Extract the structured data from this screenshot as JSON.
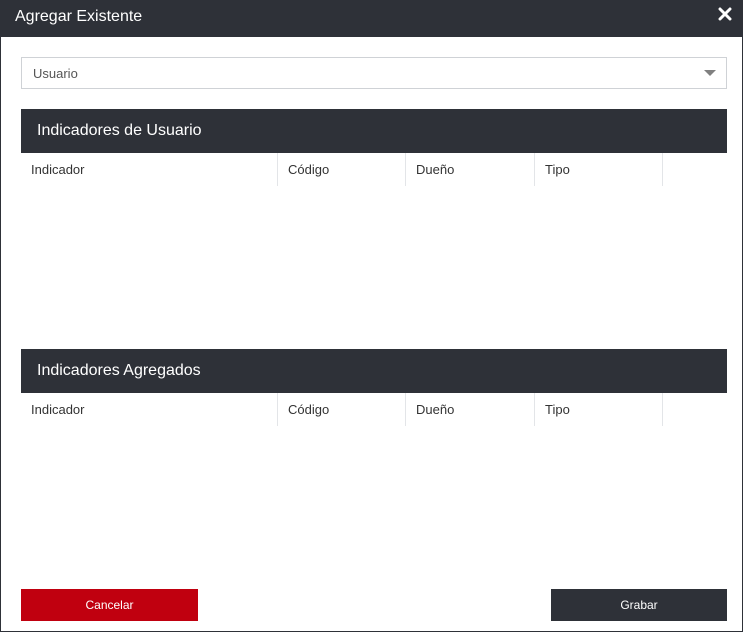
{
  "dialog": {
    "title": "Agregar Existente",
    "close_icon": "close-icon"
  },
  "user_select": {
    "value": "Usuario"
  },
  "user_indicators": {
    "heading": "Indicadores de Usuario",
    "columns": [
      "Indicador",
      "Código",
      "Dueño",
      "Tipo"
    ],
    "rows": []
  },
  "added_indicators": {
    "heading": "Indicadores Agregados",
    "columns": [
      "Indicador",
      "Código",
      "Dueño",
      "Tipo"
    ],
    "rows": []
  },
  "actions": {
    "cancel_label": "Cancelar",
    "save_label": "Grabar"
  },
  "colors": {
    "header_dark": "#2e3138",
    "cancel_red": "#c0000f"
  }
}
